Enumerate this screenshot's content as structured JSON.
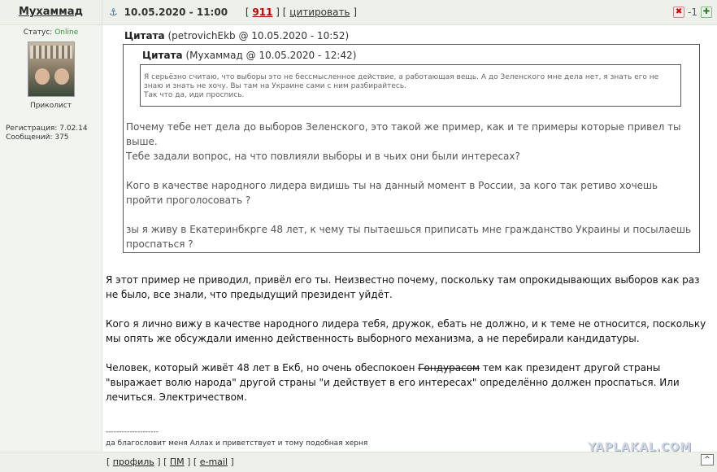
{
  "header": {
    "author_name": "Мухаммад",
    "date": "10.05.2020 - 11:00",
    "bracket_open": "[",
    "post_number": "911",
    "separator": "] [",
    "quote_link": "цитировать",
    "bracket_close": "]",
    "rating": "-1"
  },
  "sidebar": {
    "status_label": "Статус:",
    "status_value": "Online",
    "rank": "Приколист",
    "registration": "Регистрация: 7.02.14",
    "messages": "Сообщений: 375"
  },
  "quote1": {
    "title": "Цитата",
    "meta": "(petrovichEkb @ 10.05.2020 - 10:52)",
    "paragraphs": [
      "Почему тебе нет дела до выборов Зеленского, это такой же пример, как и те примеры которые привел ты выше.",
      "Тебе задали вопрос, на что повлияли выборы и в чьих они были интересах?",
      "Кого в качестве народного лидера видишь ты на данный момент в России, за кого так ретиво хочешь пройти проголосовать ?",
      "зы я живу в Екатеринбкрге 48 лет, к чему ты пытаешься приписать мне гражданство Украины и посылаешь проспаться ?"
    ]
  },
  "quote2": {
    "title": "Цитата",
    "meta": "(Мухаммад @ 10.05.2020 - 12:42)",
    "text": "Я серьёзно считаю, что выборы это не бессмысленное действие, а работающая вещь. А до Зеленского мне дела нет, я знать его не знаю и знать не хочу. Вы там на Украине сами с ним разбирайтесь.",
    "text2": "Так что да, иди проспись."
  },
  "body": {
    "p1": "Я этот пример не приводил, привёл его ты. Неизвестно почему, поскольку там опрокидывающих выборов как раз не было, все знали, что предыдущий президент уйдёт.",
    "p2": "Кого я лично вижу в качестве народного лидера тебя, дружок, ебать не должно, и к теме не относится, поскольку мы опять же обсуждали именно действенность выборного механизма, а не перебирали кандидатуры.",
    "p3_before": "Человек, который живёт 48 лет в Екб, но очень обеспокоен ",
    "p3_strike": "Гондурасом",
    "p3_after": " тем как президент другой страны \"выражает волю народа\" другой страны \"и действует в его интересах\" определённо должен проспаться. Или лечиться. Электричеством."
  },
  "signature": {
    "line": "--------------------",
    "text": "да благословит меня Аллах и приветствует и тому подобная херня"
  },
  "watermark": "YAPLAKAL.COM",
  "footer": {
    "b1": "[",
    "profile": "профиль",
    "b2": "] [",
    "pm": "ПМ",
    "b3": "] [",
    "email": "e-mail",
    "b4": "]",
    "totop": "^"
  },
  "colors": {
    "post_number": "#c00000",
    "online": "#2a9a2a",
    "header_bg": "#eef1ea"
  },
  "icons": {
    "anchor": "anchor-icon",
    "rate_down": "thumb-down-icon",
    "rate_up": "thumb-up-icon"
  }
}
